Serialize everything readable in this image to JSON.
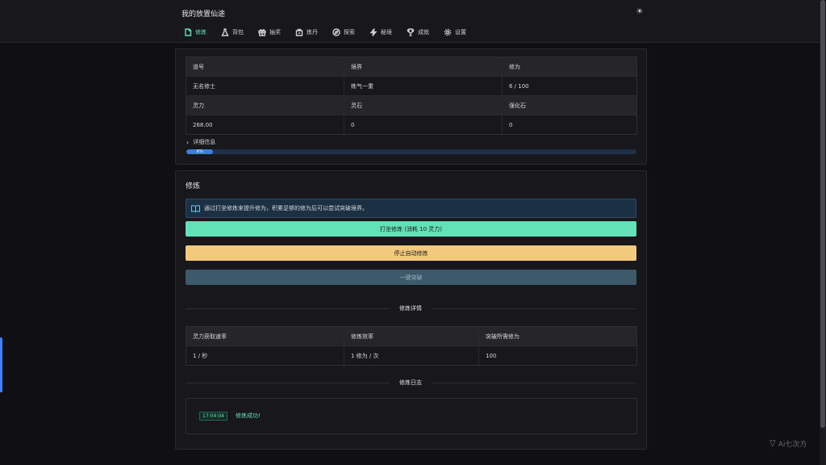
{
  "app": {
    "title": "我的放置仙途",
    "theme_icon": "sun-icon"
  },
  "nav": {
    "items": [
      {
        "label": "修炼",
        "icon": "scroll-icon",
        "active": true
      },
      {
        "label": "背包",
        "icon": "flask-icon"
      },
      {
        "label": "抽奖",
        "icon": "gift-icon"
      },
      {
        "label": "炼丹",
        "icon": "cauldron-icon"
      },
      {
        "label": "探索",
        "icon": "compass-icon"
      },
      {
        "label": "秘境",
        "icon": "bolt-icon"
      },
      {
        "label": "成就",
        "icon": "trophy-icon"
      },
      {
        "label": "设置",
        "icon": "gear-icon"
      }
    ]
  },
  "status": {
    "headers1": [
      "道号",
      "境界",
      "修为"
    ],
    "values1": [
      "无名修士",
      "练气一重",
      "6 / 100"
    ],
    "headers2": [
      "灵力",
      "灵石",
      "强化石"
    ],
    "values2": [
      "268.00",
      "0",
      "0"
    ],
    "details_label": "详细信息",
    "progress_percent": 6,
    "progress_text": "6%"
  },
  "cultivation": {
    "title": "修炼",
    "info_text": "通过打坐修炼来提升修为，积累足够的修为后可以尝试突破境界。",
    "btn_meditate": "打坐修炼 (消耗 10 灵力)",
    "btn_stop_auto": "停止自动修炼",
    "btn_breakthrough": "一键突破",
    "details_divider": "修炼详情",
    "detail_headers": [
      "灵力获取速率",
      "修炼效率",
      "突破所需修为"
    ],
    "detail_values": [
      "1 / 秒",
      "1 修为 / 次",
      "100"
    ],
    "log_divider": "修炼日志",
    "log": [
      {
        "time": "17:04:04",
        "message": "修炼成功!"
      }
    ]
  },
  "watermark": "Ai七次方",
  "colors": {
    "accent": "#63e2b7",
    "warning": "#f2c97d",
    "progress": "#3b7fde",
    "background": "#101014"
  }
}
